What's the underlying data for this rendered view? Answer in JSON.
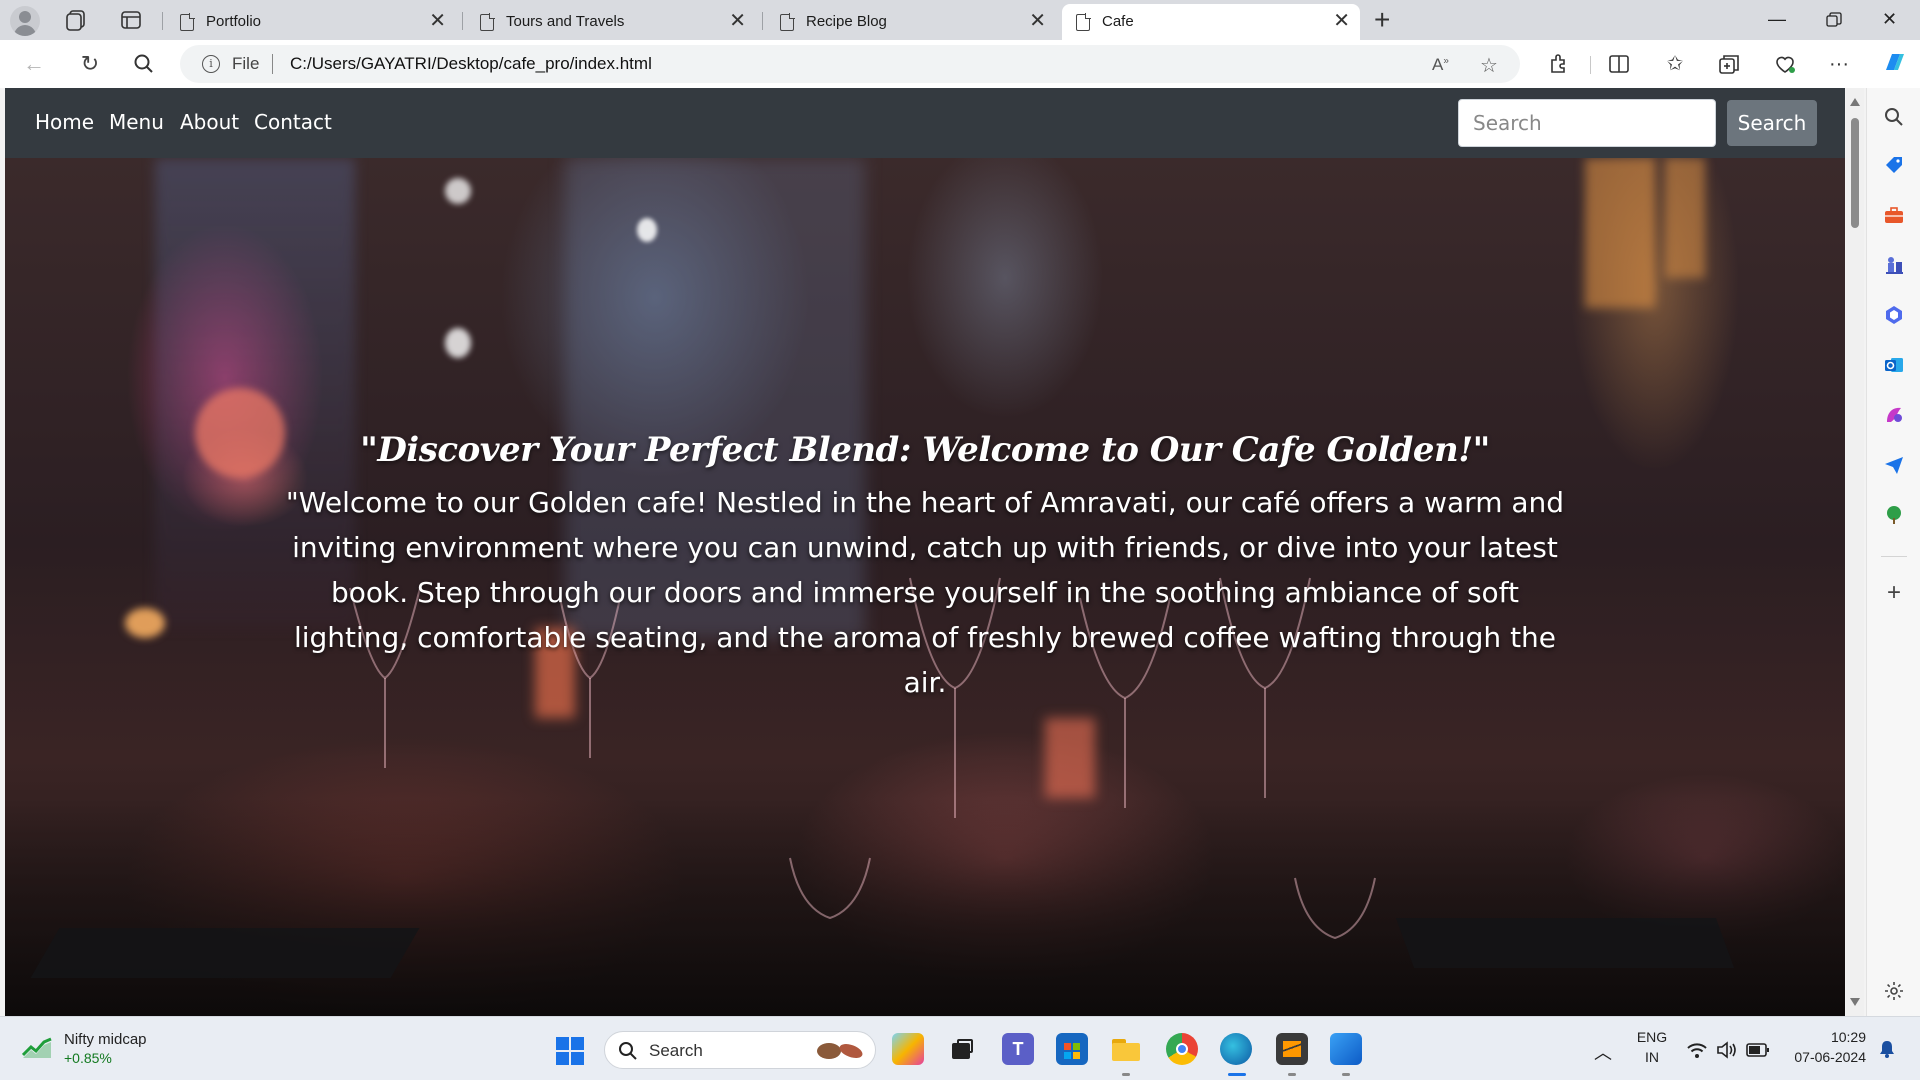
{
  "browser": {
    "tabs": [
      {
        "title": "Portfolio",
        "active": false
      },
      {
        "title": "Tours and Travels",
        "active": false
      },
      {
        "title": "Recipe Blog",
        "active": false
      },
      {
        "title": "Cafe",
        "active": true
      }
    ],
    "address": {
      "scheme_label": "File",
      "url": "C:/Users/GAYATRI/Desktop/cafe_pro/index.html"
    }
  },
  "site": {
    "nav": {
      "links": [
        "Home",
        "Menu",
        "About",
        "Contact"
      ],
      "search_placeholder": "Search",
      "search_button": "Search"
    },
    "hero": {
      "title": "\"Discover Your Perfect Blend: Welcome to Our Cafe Golden!\"",
      "text": "\"Welcome to our Golden cafe! Nestled in the heart of Amravati, our café offers a warm and inviting environment where you can unwind, catch up with friends, or dive into your latest book. Step through our doors and immerse yourself in the soothing ambiance of soft lighting, comfortable seating, and the aroma of freshly brewed coffee wafting through the air."
    }
  },
  "taskbar": {
    "widget": {
      "name": "Nifty midcap",
      "change": "+0.85%"
    },
    "search_label": "Search",
    "tray": {
      "lang_top": "ENG",
      "lang_bottom": "IN",
      "time": "10:29",
      "date": "07-06-2024"
    }
  },
  "colors": {
    "site_nav_bg": "#343a40",
    "search_button_bg": "#6c757d",
    "hero_text": "#ffffff"
  }
}
